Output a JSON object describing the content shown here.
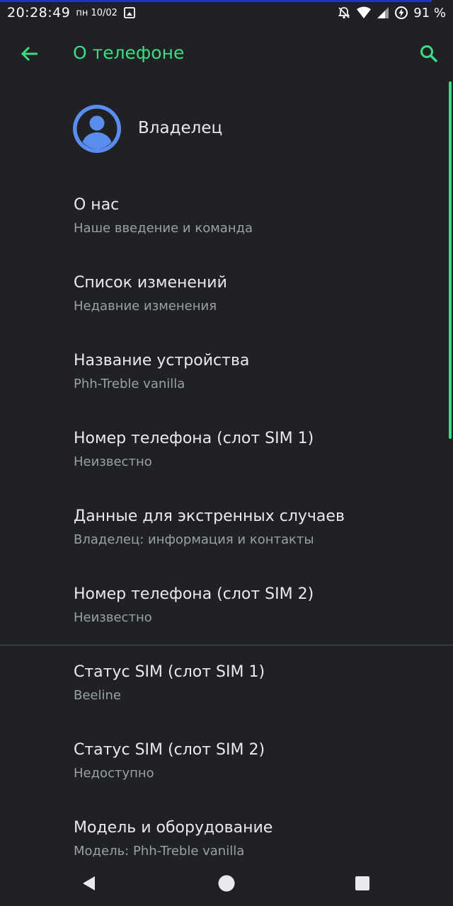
{
  "status_bar": {
    "time": "20:28:49",
    "date": "пн 10/02",
    "battery_percent": "91 %"
  },
  "app_bar": {
    "title": "О телефоне",
    "back_icon": "arrow-back-icon",
    "search_icon": "search-icon"
  },
  "owner": {
    "name": "Владелец",
    "avatar_icon": "account-circle-icon"
  },
  "items": [
    {
      "title": "О нас",
      "subtitle": "Наше введение и команда"
    },
    {
      "title": "Список изменений",
      "subtitle": "Недавние изменения"
    },
    {
      "title": "Название устройства",
      "subtitle": "Phh-Treble vanilla"
    },
    {
      "title": "Номер телефона (слот SIM 1)",
      "subtitle": "Неизвестно"
    },
    {
      "title": "Данные для экстренных случаев",
      "subtitle": "Владелец: информация и контакты"
    },
    {
      "title": "Номер телефона (слот SIM 2)",
      "subtitle": "Неизвестно"
    },
    {
      "title": "Статус SIM (слот SIM 1)",
      "subtitle": "Beeline"
    },
    {
      "title": "Статус SIM (слот SIM 2)",
      "subtitle": "Недоступно"
    },
    {
      "title": "Модель и оборудование",
      "subtitle": "Модель: Phh-Treble vanilla"
    }
  ],
  "nav_bar": {
    "back": "nav-back-icon",
    "home": "nav-home-icon",
    "recents": "nav-recents-icon"
  },
  "colors": {
    "accent": "#3ddc84",
    "background": "#202124",
    "primary_text": "#e8eaed",
    "secondary_text": "#9aa0a6",
    "avatar": "#5b8def"
  }
}
